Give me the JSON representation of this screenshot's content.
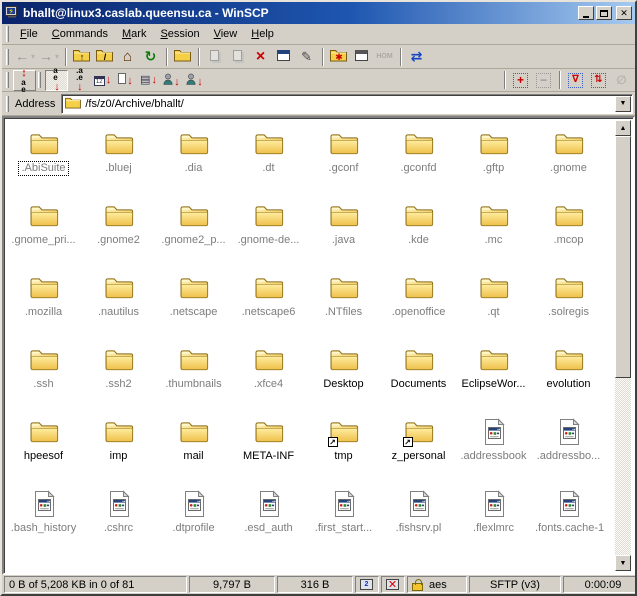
{
  "window": {
    "title": "bhallt@linux3.caslab.queensu.ca - WinSCP"
  },
  "menu": {
    "items": [
      "File",
      "Commands",
      "Mark",
      "Session",
      "View",
      "Help"
    ]
  },
  "toolbar_main": [
    {
      "name": "back",
      "icon": "arrow-left",
      "disabled": true,
      "dropdown": true
    },
    {
      "name": "forward",
      "icon": "arrow-right",
      "disabled": true,
      "dropdown": true
    },
    {
      "sep": 1
    },
    {
      "name": "parent-directory",
      "icon": "folder-up"
    },
    {
      "name": "root-directory",
      "icon": "folder-root"
    },
    {
      "name": "home-directory",
      "icon": "home"
    },
    {
      "name": "refresh",
      "icon": "refresh"
    },
    {
      "sep": 1
    },
    {
      "name": "open-directory",
      "icon": "folder-open"
    },
    {
      "sep": 1
    },
    {
      "name": "copy",
      "icon": "copy",
      "disabled": true
    },
    {
      "name": "move",
      "icon": "move",
      "disabled": true
    },
    {
      "name": "delete",
      "icon": "delete"
    },
    {
      "name": "properties",
      "icon": "properties"
    },
    {
      "name": "rename",
      "icon": "rename"
    },
    {
      "sep": 1
    },
    {
      "name": "create-directory",
      "icon": "folder-new"
    },
    {
      "name": "console",
      "icon": "console"
    },
    {
      "name": "hom",
      "label": "HOM",
      "disabled": true
    },
    {
      "sep": 1
    },
    {
      "name": "synchronize",
      "icon": "synchronize"
    }
  ],
  "toolbar_sort": [
    {
      "name": "sort-toggle",
      "icon": "sort-toggle",
      "raised": true
    },
    {
      "grip": 1
    },
    {
      "name": "sort-by-name",
      "icon": "sort-name",
      "latched": true
    },
    {
      "name": "sort-by-extension",
      "icon": "sort-ext"
    },
    {
      "name": "sort-by-changed",
      "icon": "sort-date"
    },
    {
      "name": "sort-by-size",
      "icon": "sort-size"
    },
    {
      "name": "sort-by-rights",
      "icon": "sort-rights"
    },
    {
      "name": "sort-by-owner",
      "icon": "sort-owner"
    },
    {
      "name": "sort-by-group",
      "icon": "sort-group"
    },
    {
      "spacer": 1
    },
    {
      "sep": 1
    },
    {
      "name": "select",
      "icon": "select"
    },
    {
      "name": "unselect",
      "icon": "unselect"
    },
    {
      "sep": 1
    },
    {
      "name": "invert-selection",
      "icon": "invert"
    },
    {
      "name": "restore-selection",
      "icon": "restore"
    },
    {
      "name": "clear-selection",
      "icon": "clear",
      "disabled": true
    }
  ],
  "address": {
    "label": "Address",
    "path": "/fs/z0/Archive/bhallt/"
  },
  "files": [
    {
      "name": ".AbiSuite",
      "type": "folder",
      "focused": true
    },
    {
      "name": ".bluej",
      "type": "folder"
    },
    {
      "name": ".dia",
      "type": "folder"
    },
    {
      "name": ".dt",
      "type": "folder"
    },
    {
      "name": ".gconf",
      "type": "folder"
    },
    {
      "name": ".gconfd",
      "type": "folder"
    },
    {
      "name": ".gftp",
      "type": "folder"
    },
    {
      "name": ".gnome",
      "type": "folder"
    },
    {
      "name": ".gnome_pri...",
      "type": "folder"
    },
    {
      "name": ".gnome2",
      "type": "folder"
    },
    {
      "name": ".gnome2_p...",
      "type": "folder"
    },
    {
      "name": ".gnome-de...",
      "type": "folder"
    },
    {
      "name": ".java",
      "type": "folder"
    },
    {
      "name": ".kde",
      "type": "folder"
    },
    {
      "name": ".mc",
      "type": "folder"
    },
    {
      "name": ".mcop",
      "type": "folder"
    },
    {
      "name": ".mozilla",
      "type": "folder"
    },
    {
      "name": ".nautilus",
      "type": "folder"
    },
    {
      "name": ".netscape",
      "type": "folder"
    },
    {
      "name": ".netscape6",
      "type": "folder"
    },
    {
      "name": ".NTfiles",
      "type": "folder"
    },
    {
      "name": ".openoffice",
      "type": "folder"
    },
    {
      "name": ".qt",
      "type": "folder"
    },
    {
      "name": ".solregis",
      "type": "folder"
    },
    {
      "name": ".ssh",
      "type": "folder"
    },
    {
      "name": ".ssh2",
      "type": "folder"
    },
    {
      "name": ".thumbnails",
      "type": "folder"
    },
    {
      "name": ".xfce4",
      "type": "folder"
    },
    {
      "name": "Desktop",
      "type": "folder"
    },
    {
      "name": "Documents",
      "type": "folder"
    },
    {
      "name": "EclipseWor...",
      "type": "folder"
    },
    {
      "name": "evolution",
      "type": "folder"
    },
    {
      "name": "hpeesof",
      "type": "folder"
    },
    {
      "name": "imp",
      "type": "folder"
    },
    {
      "name": "mail",
      "type": "folder"
    },
    {
      "name": "META-INF",
      "type": "folder"
    },
    {
      "name": "tmp",
      "type": "folder",
      "shortcut": true
    },
    {
      "name": "z_personal",
      "type": "folder",
      "shortcut": true
    },
    {
      "name": ".addressbook",
      "type": "file"
    },
    {
      "name": ".addressbo...",
      "type": "file"
    },
    {
      "name": ".bash_history",
      "type": "file"
    },
    {
      "name": ".cshrc",
      "type": "file"
    },
    {
      "name": ".dtprofile",
      "type": "file"
    },
    {
      "name": ".esd_auth",
      "type": "file"
    },
    {
      "name": ".first_start...",
      "type": "file"
    },
    {
      "name": ".fishsrv.pl",
      "type": "file"
    },
    {
      "name": ".flexlmrc",
      "type": "file"
    },
    {
      "name": ".fonts.cache-1",
      "type": "file"
    }
  ],
  "status": {
    "panels": [
      {
        "key": "summary",
        "text": "0 B of 5,208 KB in 0 of 81",
        "width": 183,
        "align": "left"
      },
      {
        "key": "focused-size",
        "text": "9,797 B",
        "width": 86,
        "align": "center"
      },
      {
        "key": "secondary-size",
        "text": "316 B",
        "width": 76,
        "align": "center"
      },
      {
        "key": "console",
        "icon": "console-icon",
        "width": 24
      },
      {
        "key": "x11-blocked",
        "icon": "blocked-icon",
        "width": 24
      },
      {
        "key": "encryption",
        "icon": "lock-icon",
        "text": "aes",
        "width": 60,
        "align": "left"
      },
      {
        "key": "protocol",
        "text": "SFTP (v3)",
        "width": 92,
        "align": "center"
      },
      {
        "key": "duration",
        "text": "0:00:09",
        "width": 80,
        "align": "center"
      }
    ]
  },
  "colors": {
    "titlebar_left": "#0a246a",
    "titlebar_right": "#a6caf0",
    "chrome": "#d4d0c8",
    "folder": "#f5cf48",
    "hidden_label": "#7d7d7d",
    "delete_red": "#cc0000",
    "sort_arrow": "#cc0000"
  }
}
